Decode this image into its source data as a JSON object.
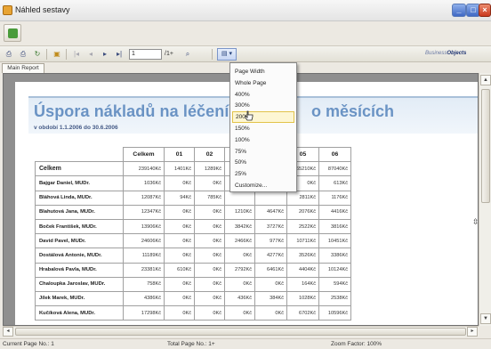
{
  "window": {
    "title": "Náhled sestavy"
  },
  "toolbar": {
    "page_value": "1",
    "page_total": "/1+",
    "zoom_button": "▤ ▾",
    "brand_prefix": "Business",
    "brand_suffix": "Objects"
  },
  "tabs": [
    {
      "label": "Main Report"
    }
  ],
  "report": {
    "title": "Úspora nákladů na léčení v",
    "title_end": "o měsících",
    "period": "v období 1.1.2006 do 30.6.2006",
    "columns": [
      "Celkem",
      "01",
      "02",
      "",
      "",
      "05",
      "06"
    ],
    "rows": [
      {
        "name": "Celkem",
        "values": [
          "239140Kč",
          "1401Kč",
          "1289Kč",
          "",
          "",
          "65210Kč",
          "87040Kč"
        ]
      },
      {
        "name": "Bajgar Daniel, MUDr.",
        "values": [
          "1036Kč",
          "0Kč",
          "0Kč",
          "",
          "",
          "0Kč",
          "613Kč"
        ]
      },
      {
        "name": "Bláhová Linda, MUDr.",
        "values": [
          "12087Kč",
          "94Kč",
          "785Kč",
          "",
          "",
          "2811Kč",
          "1176Kč"
        ]
      },
      {
        "name": "Blahutová Jana, MUDr.",
        "values": [
          "12347Kč",
          "0Kč",
          "0Kč",
          "1210Kč",
          "4647Kč",
          "2076Kč",
          "4416Kč"
        ]
      },
      {
        "name": "Boček František, MUDr.",
        "values": [
          "13906Kč",
          "0Kč",
          "0Kč",
          "3842Kč",
          "3727Kč",
          "2522Kč",
          "3816Kč"
        ]
      },
      {
        "name": "David Pavel, MUDr.",
        "values": [
          "24606Kč",
          "0Kč",
          "0Kč",
          "2466Kč",
          "977Kč",
          "10711Kč",
          "10451Kč"
        ]
      },
      {
        "name": "Dostálová Antonie, MUDr.",
        "values": [
          "11189Kč",
          "0Kč",
          "0Kč",
          "0Kč",
          "4277Kč",
          "3526Kč",
          "3386Kč"
        ]
      },
      {
        "name": "Hrabalová Pavla, MUDr.",
        "values": [
          "23381Kč",
          "610Kč",
          "0Kč",
          "2792Kč",
          "6461Kč",
          "4404Kč",
          "10124Kč"
        ]
      },
      {
        "name": "Chaloupka Jaroslav, MUDr.",
        "values": [
          "758Kč",
          "0Kč",
          "0Kč",
          "0Kč",
          "0Kč",
          "164Kč",
          "594Kč"
        ]
      },
      {
        "name": "Jílek Marek, MUDr.",
        "values": [
          "4386Kč",
          "0Kč",
          "0Kč",
          "436Kč",
          "384Kč",
          "1028Kč",
          "2538Kč"
        ]
      },
      {
        "name": "Kučíková Alena, MUDr.",
        "values": [
          "17298Kč",
          "0Kč",
          "0Kč",
          "0Kč",
          "0Kč",
          "6702Kč",
          "10596Kč"
        ]
      }
    ]
  },
  "zoom_menu": {
    "items": [
      "Page Width",
      "Whole Page",
      "400%",
      "300%",
      "200%",
      "150%",
      "100%",
      "75%",
      "50%",
      "25%",
      "Customize..."
    ],
    "selected": "200%"
  },
  "status": {
    "current_page": "Current Page No.: 1",
    "total_page": "Total Page No.: 1+",
    "zoom_factor": "Zoom Factor: 100%"
  },
  "colors": {
    "title": "#6a93c4",
    "menu_highlight": "#fdf6d3",
    "canvas": "#8f8f8f"
  },
  "icons": [
    "app-icon",
    "export-icon",
    "print-icon",
    "refresh-icon",
    "group-tree-icon",
    "first-page-icon",
    "prev-page-icon",
    "next-page-icon",
    "last-page-icon",
    "search-icon",
    "zoom-icon",
    "minimize-icon",
    "maximize-icon",
    "close-icon"
  ]
}
